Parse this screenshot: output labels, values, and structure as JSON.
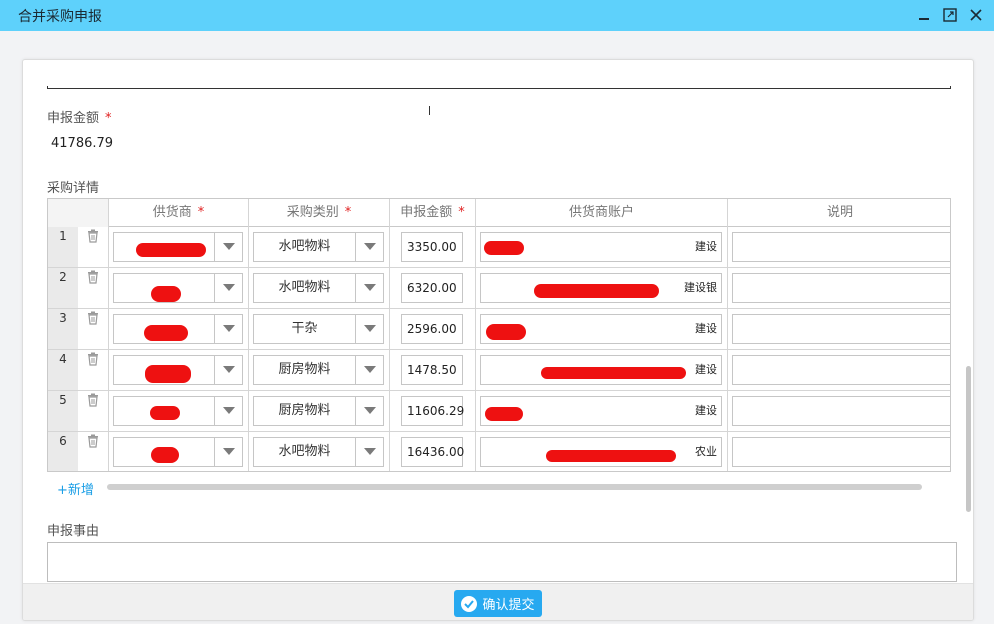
{
  "window": {
    "title": "合并采购申报"
  },
  "form": {
    "amount_label": "申报金额",
    "required_mark": "*",
    "amount_value": "41786.79",
    "details_label": "采购详情",
    "reason_label": "申报事由",
    "add_label": "+新增",
    "submit_label": "确认提交"
  },
  "table": {
    "headers": [
      "供货商",
      "采购类别",
      "申报金额",
      "供货商账户",
      "说明"
    ],
    "rows": [
      {
        "index": "1",
        "category": "水吧物料",
        "amount": "3350.00",
        "bank": "建设"
      },
      {
        "index": "2",
        "category": "水吧物料",
        "amount": "6320.00",
        "bank": "建设银"
      },
      {
        "index": "3",
        "category": "干杂",
        "amount": "2596.00",
        "bank": "建设"
      },
      {
        "index": "4",
        "category": "厨房物料",
        "amount": "1478.50",
        "bank": "建设"
      },
      {
        "index": "5",
        "category": "厨房物料",
        "amount": "11606.29",
        "bank": "建设"
      },
      {
        "index": "6",
        "category": "水吧物料",
        "amount": "16436.00",
        "bank": "农业"
      }
    ]
  },
  "colors": {
    "titlebar": "#5ed1fb",
    "accent": "#27a9f0",
    "redaction": "#ee1111"
  },
  "icons": [
    "minimize-icon",
    "maximize-icon",
    "close-icon",
    "trash-icon",
    "chevron-down-icon",
    "check-circle-icon"
  ]
}
